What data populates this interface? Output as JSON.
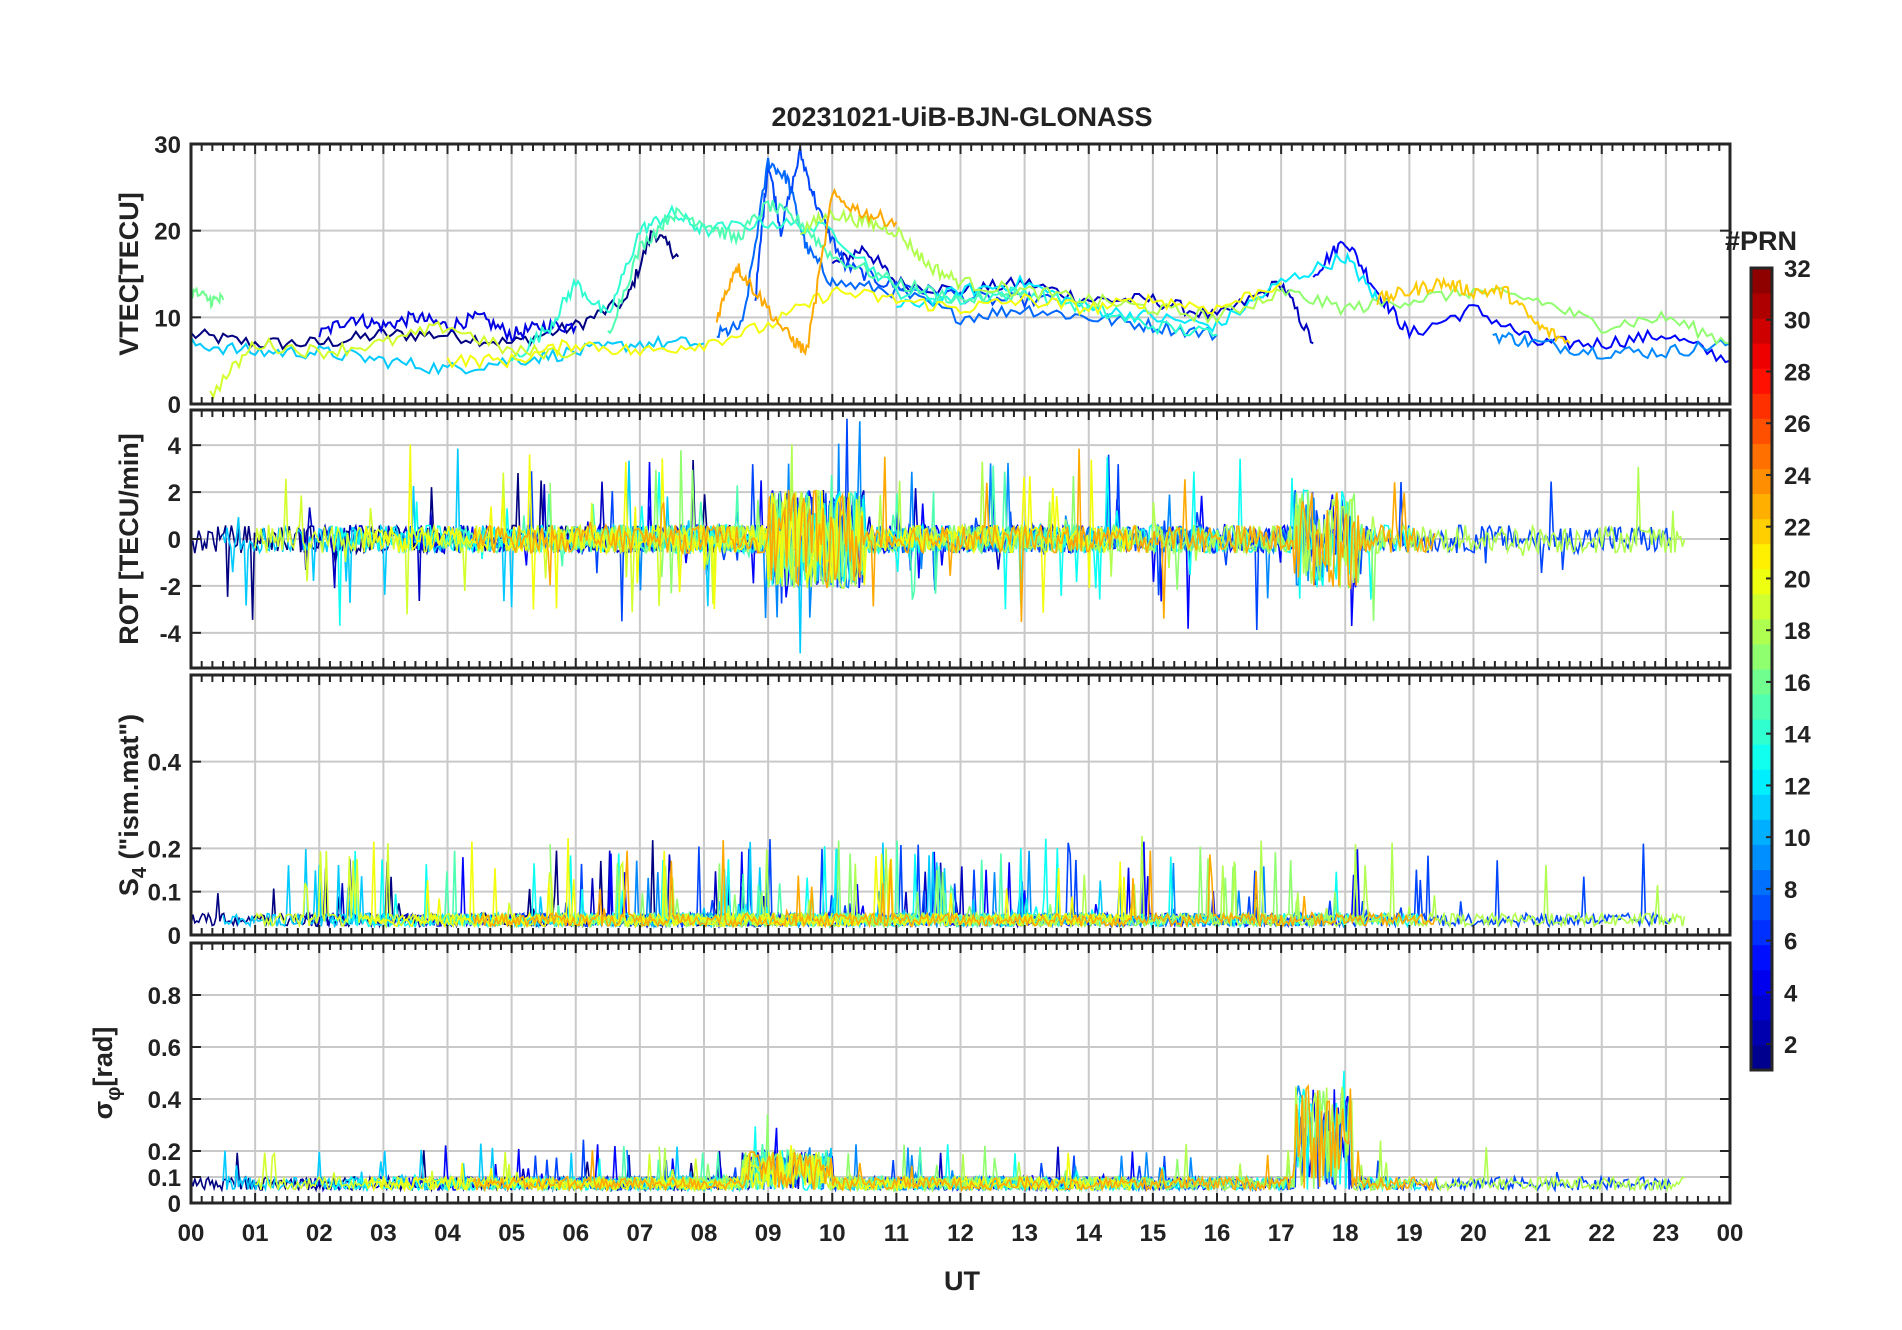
{
  "chart_data": {
    "type": "line",
    "title": "20231021-UiB-BJN-GLONASS",
    "xlabel": "UT",
    "x_tick_labels": [
      "00",
      "01",
      "02",
      "03",
      "04",
      "05",
      "06",
      "07",
      "08",
      "09",
      "10",
      "11",
      "12",
      "13",
      "14",
      "15",
      "16",
      "17",
      "18",
      "19",
      "20",
      "21",
      "22",
      "23",
      "00"
    ],
    "xlim_hours": [
      0,
      24
    ],
    "grid": true,
    "colorbar": {
      "title": "#PRN",
      "range": [
        1,
        32
      ],
      "ticks": [
        2,
        4,
        6,
        8,
        10,
        12,
        14,
        16,
        18,
        20,
        22,
        24,
        26,
        28,
        30,
        32
      ],
      "colormap": "jet"
    },
    "panels": [
      {
        "id": "vtec",
        "ylabel": "VTEC[TECU]",
        "ylim": [
          0,
          30
        ],
        "yticks": [
          0,
          10,
          20,
          30
        ],
        "series": [
          {
            "prn": 1,
            "x": [
              0,
              1,
              2,
              3,
              4,
              5,
              6,
              6.8,
              7.2,
              7.6
            ],
            "y": [
              8,
              7,
              7,
              8,
              8,
              7,
              9,
              12,
              20,
              17
            ]
          },
          {
            "prn": 3,
            "x": [
              10,
              10.5,
              11,
              12,
              13,
              14,
              15,
              16,
              17,
              17.5
            ],
            "y": [
              16,
              18,
              14,
              13,
              14,
              12,
              12,
              10,
              14,
              7
            ]
          },
          {
            "prn": 4,
            "x": [
              2,
              2.5,
              3,
              3.5,
              4,
              4.5,
              5,
              5.5,
              6
            ],
            "y": [
              8,
              10,
              9,
              10,
              9,
              10,
              8,
              9,
              9
            ]
          },
          {
            "prn": 5,
            "x": [
              17.5,
              18,
              18.5,
              19,
              20,
              21,
              22,
              23,
              24
            ],
            "y": [
              15,
              19,
              13,
              8,
              11,
              7,
              7,
              8,
              5
            ]
          },
          {
            "prn": 7,
            "x": [
              8.8,
              9.0,
              9.2,
              9.5,
              9.8,
              10.2,
              10.8,
              11.5,
              12.5,
              13.5
            ],
            "y": [
              12,
              28,
              20,
              29,
              22,
              16,
              14,
              13,
              12,
              12
            ]
          },
          {
            "prn": 8,
            "x": [
              8.2,
              8.6,
              9.0,
              9.3,
              9.6,
              10.0,
              11,
              12,
              13,
              14,
              15,
              16
            ],
            "y": [
              8,
              9,
              28,
              26,
              18,
              14,
              13,
              10,
              11,
              10,
              9,
              8
            ]
          },
          {
            "prn": 9,
            "x": [
              20.3,
              21,
              22,
              23,
              24
            ],
            "y": [
              8,
              7,
              6,
              6,
              7
            ]
          },
          {
            "prn": 11,
            "x": [
              0,
              1,
              2,
              3,
              4,
              5,
              6,
              7,
              8
            ],
            "y": [
              7,
              6,
              6,
              5,
              4,
              5,
              6,
              7,
              7
            ]
          },
          {
            "prn": 12,
            "x": [
              11,
              12,
              13,
              14,
              15,
              16,
              17,
              18,
              18.5
            ],
            "y": [
              11,
              13,
              14,
              11,
              10,
              9,
              14,
              17,
              12
            ]
          },
          {
            "prn": 14,
            "x": [
              5,
              5.6,
              6,
              6.5,
              7,
              7.5,
              8,
              9,
              10,
              11,
              12,
              13,
              14,
              15,
              16
            ],
            "y": [
              5,
              9,
              14,
              10,
              20,
              22,
              20,
              21,
              20,
              13,
              12,
              13,
              11,
              9,
              8
            ]
          },
          {
            "prn": 15,
            "x": [
              6.5,
              7,
              7.5,
              8,
              8.5,
              9,
              9.5,
              10,
              11,
              12,
              13
            ],
            "y": [
              8,
              18,
              22,
              21,
              19,
              23,
              21,
              17,
              14,
              12,
              13
            ]
          },
          {
            "prn": 16,
            "x": [
              0,
              0.3,
              0.5
            ],
            "y": [
              13,
              12,
              12
            ]
          },
          {
            "prn": 17,
            "x": [
              17,
              18,
              19,
              20,
              21,
              22,
              23,
              24
            ],
            "y": [
              13,
              11,
              12,
              13,
              12,
              9,
              10,
              7
            ]
          },
          {
            "prn": 18,
            "x": [
              9.5,
              10,
              10.5,
              11,
              11.5,
              12,
              13,
              14,
              15,
              16,
              17
            ],
            "y": [
              20,
              22,
              21,
              20,
              16,
              14,
              13,
              12,
              11,
              10,
              13
            ]
          },
          {
            "prn": 19,
            "x": [
              0.3,
              1,
              2,
              3,
              4,
              5,
              6
            ],
            "y": [
              1,
              7,
              6,
              7,
              9,
              6,
              6
            ]
          },
          {
            "prn": 20,
            "x": [
              4,
              5,
              6,
              7,
              8,
              9,
              10,
              11,
              12,
              13,
              14,
              15,
              16,
              17
            ],
            "y": [
              5,
              5,
              7,
              6,
              7,
              9,
              13,
              12,
              11,
              12,
              11,
              12,
              11,
              14
            ]
          },
          {
            "prn": 22,
            "x": [
              18.5,
              19,
              19.5,
              20,
              20.5,
              21,
              21.5
            ],
            "y": [
              12,
              13,
              14,
              13,
              13,
              9,
              7
            ]
          },
          {
            "prn": 23,
            "x": [
              8.2,
              8.5,
              8.8,
              9.3,
              9.6,
              10,
              10.5,
              11
            ],
            "y": [
              10,
              16,
              13,
              8,
              6,
              24,
              22,
              21
            ]
          }
        ]
      },
      {
        "id": "rot",
        "ylabel": "ROT [TECU/min]",
        "ylim": [
          -5.5,
          5.5
        ],
        "yticks": [
          -4,
          -2,
          0,
          2,
          4
        ]
      },
      {
        "id": "s4",
        "ylabel": "S4 (\"ism.mat\")",
        "ylabel_main": "S",
        "ylabel_sub": "4",
        "ylabel_rest": " (\"ism.mat\")",
        "ylim": [
          0,
          0.6
        ],
        "yticks": [
          0,
          0.1,
          0.2,
          0.4
        ],
        "ytick_labels": [
          "0",
          "0.1",
          "0.2",
          "0.4"
        ]
      },
      {
        "id": "sigma_phi",
        "ylabel": "σφ[rad]",
        "ylabel_main": "σ",
        "ylabel_sub": "φ",
        "ylabel_rest": "[rad]",
        "ylim": [
          0,
          1
        ],
        "yticks": [
          0,
          0.1,
          0.2,
          0.4,
          0.6,
          0.8
        ],
        "ytick_labels": [
          "0",
          "0.1",
          "0.2",
          "0.4",
          "0.6",
          "0.8"
        ]
      }
    ]
  }
}
